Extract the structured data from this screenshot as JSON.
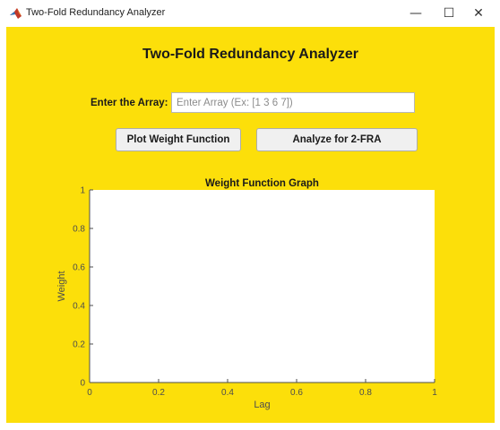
{
  "window": {
    "title": "Two-Fold Redundancy Analyzer",
    "minimize_glyph": "—",
    "maximize_glyph": "☐",
    "close_glyph": "✕"
  },
  "header": {
    "title": "Two-Fold Redundancy Analyzer"
  },
  "form": {
    "array_label": "Enter the Array:",
    "array_value": "",
    "array_placeholder": "Enter Array (Ex: [1 3 6 7])"
  },
  "buttons": {
    "plot_label": "Plot Weight Function",
    "analyze_label": "Analyze for 2-FRA"
  },
  "colors": {
    "panel_bg": "#fcdf0a",
    "axis_color": "#4d4d4d"
  },
  "icons": {
    "app_icon": "matlab-logo-icon"
  },
  "chart_data": {
    "type": "line",
    "title": "Weight Function Graph",
    "xlabel": "Lag",
    "ylabel": "Weight",
    "xlim": [
      0,
      1
    ],
    "ylim": [
      0,
      1
    ],
    "xticks": [
      0,
      0.2,
      0.4,
      0.6,
      0.8,
      1
    ],
    "yticks": [
      0,
      0.2,
      0.4,
      0.6,
      0.8,
      1
    ],
    "xtick_labels": [
      "0",
      "0.2",
      "0.4",
      "0.6",
      "0.8",
      "1"
    ],
    "ytick_labels": [
      "0",
      "0.2",
      "0.4",
      "0.6",
      "0.8",
      "1"
    ],
    "grid": false,
    "series": []
  }
}
